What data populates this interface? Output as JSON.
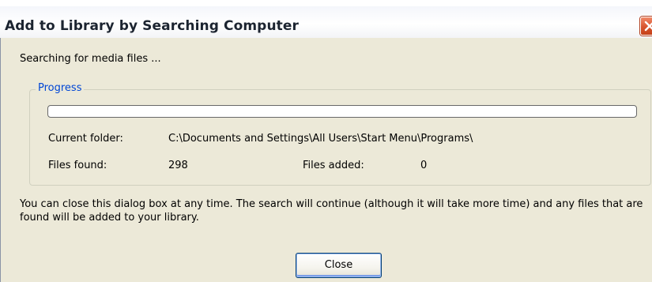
{
  "window": {
    "title": "Add to Library by Searching Computer"
  },
  "icons": {
    "close": "close-icon"
  },
  "status_text": "Searching for media files ...",
  "progress_group": {
    "label": "Progress",
    "progress_fraction": 0.0,
    "current_folder_label": "Current folder:",
    "current_folder_value": "C:\\Documents and Settings\\All Users\\Start Menu\\Programs\\",
    "files_found_label": "Files found:",
    "files_found_value": "298",
    "files_added_label": "Files added:",
    "files_added_value": "0"
  },
  "info_text": "You can close this dialog box at any time. The search will continue (although it will take more time) and any files that are found will be added to your library.",
  "buttons": {
    "close_label": "Close"
  },
  "colors": {
    "title_close_button": "#d8542e",
    "group_label": "#0046d5",
    "dialog_background": "#ece9d8",
    "button_border": "#003c74"
  }
}
